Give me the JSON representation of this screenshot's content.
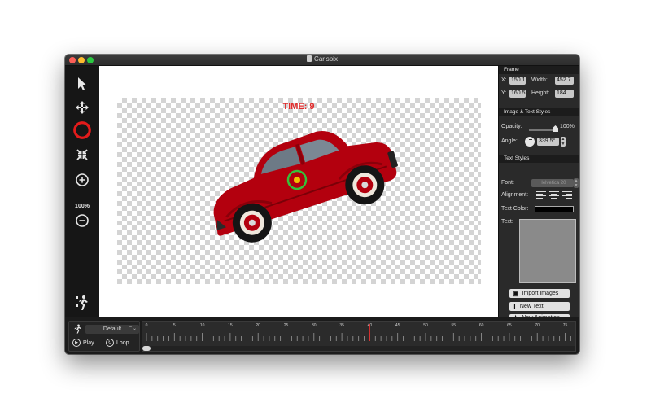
{
  "window": {
    "title": "Car.spix"
  },
  "toolbar": {
    "tools": [
      {
        "name": "select-arrow-icon"
      },
      {
        "name": "move-arrows-icon"
      },
      {
        "name": "rotate-ring-icon",
        "accent": "#e21b1b"
      },
      {
        "name": "shrink-arrows-icon"
      },
      {
        "name": "zoom-in-icon"
      },
      {
        "name": "zoom-out-icon"
      },
      {
        "name": "character-animation-icon"
      }
    ],
    "zoom_label": "100%"
  },
  "canvas": {
    "time_label": "TIME: 9",
    "time_color": "#e12c2c",
    "car_color": "#b3000e",
    "rotation_handle_color": "#36c23a"
  },
  "panel": {
    "frame": {
      "heading": "Frame",
      "x_label": "X:",
      "x_value": "150.1",
      "y_label": "Y:",
      "y_value": "160.5",
      "width_label": "Width:",
      "width_value": "452.7",
      "height_label": "Height:",
      "height_value": "184"
    },
    "image_text_styles": {
      "heading": "Image & Text Styles",
      "opacity_label": "Opacity:",
      "opacity_value": "100%",
      "angle_label": "Angle:",
      "angle_value": "339.5°"
    },
    "text_styles": {
      "heading": "Text Styles",
      "font_label": "Font:",
      "font_value": "Helvetica 20",
      "alignment_label": "Alignment:",
      "text_color_label": "Text Color:",
      "text_label": "Text:"
    },
    "buttons": {
      "import_images": "Import Images",
      "new_text": "New Text",
      "new_animation": "New Animation"
    }
  },
  "bottom": {
    "animation_select": "Default",
    "play_label": "Play",
    "loop_label": "Loop",
    "timeline": {
      "ticks": [
        "0",
        "5",
        "10",
        "15",
        "20",
        "25",
        "30",
        "35",
        "40",
        "45",
        "50",
        "55",
        "60",
        "65",
        "70",
        "75"
      ],
      "marker_color": "#e12c2c"
    }
  }
}
